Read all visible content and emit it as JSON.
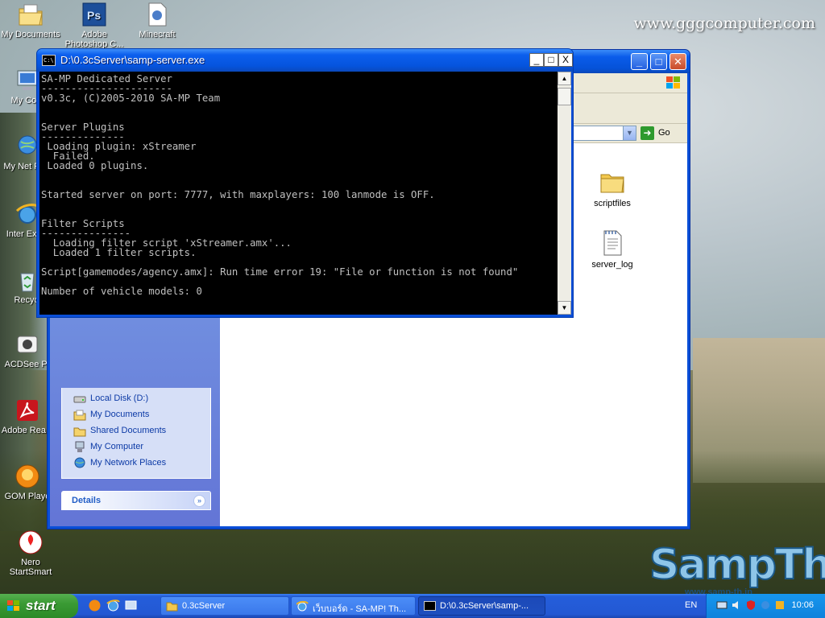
{
  "watermark": "www.gggcomputer.com",
  "logo": {
    "text": "SampTh",
    "sub": "www.samp-th.in"
  },
  "desktop_icons": [
    {
      "label": "My Documents"
    },
    {
      "label": "Adobe Photoshop C..."
    },
    {
      "label": "Minecraft"
    },
    {
      "label": "My Com"
    },
    {
      "label": "My Net Plac"
    },
    {
      "label": "Inter Explo"
    },
    {
      "label": "Recycl"
    },
    {
      "label": "ACDSee Pr"
    },
    {
      "label": "Adobe Rea 8"
    },
    {
      "label": "GOM Playe"
    },
    {
      "label": "Nero StartSmart"
    }
  ],
  "console": {
    "title": "D:\\0.3cServer\\samp-server.exe",
    "lines": [
      "SA-MP Dedicated Server",
      "----------------------",
      "v0.3c, (C)2005-2010 SA-MP Team",
      "",
      "",
      "Server Plugins",
      "--------------",
      " Loading plugin: xStreamer",
      "  Failed.",
      " Loaded 0 plugins.",
      "",
      "",
      "Started server on port: 7777, with maxplayers: 100 lanmode is OFF.",
      "",
      "",
      "Filter Scripts",
      "---------------",
      "  Loading filter script 'xStreamer.amx'...",
      "  Loaded 1 filter scripts.",
      "",
      "Script[gamemodes/agency.amx]: Run time error 19: \"File or function is not found\"",
      "",
      "Number of vehicle models: 0"
    ],
    "buttons": {
      "minimize": "_",
      "maximize": "□",
      "close": "X"
    },
    "icon_text": "C:\\"
  },
  "explorer": {
    "go_label": "Go",
    "files": [
      {
        "name": "scriptfiles",
        "icon": "folder-icon"
      },
      {
        "name": "server_log",
        "icon": "text-file-icon"
      }
    ],
    "other_places": [
      {
        "label": "Local Disk (D:)",
        "icon": "drive-icon"
      },
      {
        "label": "My Documents",
        "icon": "documents-folder-icon"
      },
      {
        "label": "Shared Documents",
        "icon": "folder-icon"
      },
      {
        "label": "My Computer",
        "icon": "computer-icon"
      },
      {
        "label": "My Network Places",
        "icon": "network-icon"
      }
    ],
    "details_title": "Details"
  },
  "taskbar": {
    "start_label": "start",
    "tasks": [
      {
        "label": "0.3cServer",
        "icon": "folder-icon"
      },
      {
        "label": "เว็บบอร์ด - SA-MP! Th...",
        "icon": "ie-icon"
      },
      {
        "label": "D:\\0.3cServer\\samp-...",
        "icon": "console-icon"
      }
    ],
    "language": "EN",
    "clock": "10:06"
  },
  "colors": {
    "xp_blue": "#0a4fd8",
    "console_text": "#c0c0c0",
    "start_green": "#3a9a34",
    "link_blue": "#0c3aa6"
  }
}
